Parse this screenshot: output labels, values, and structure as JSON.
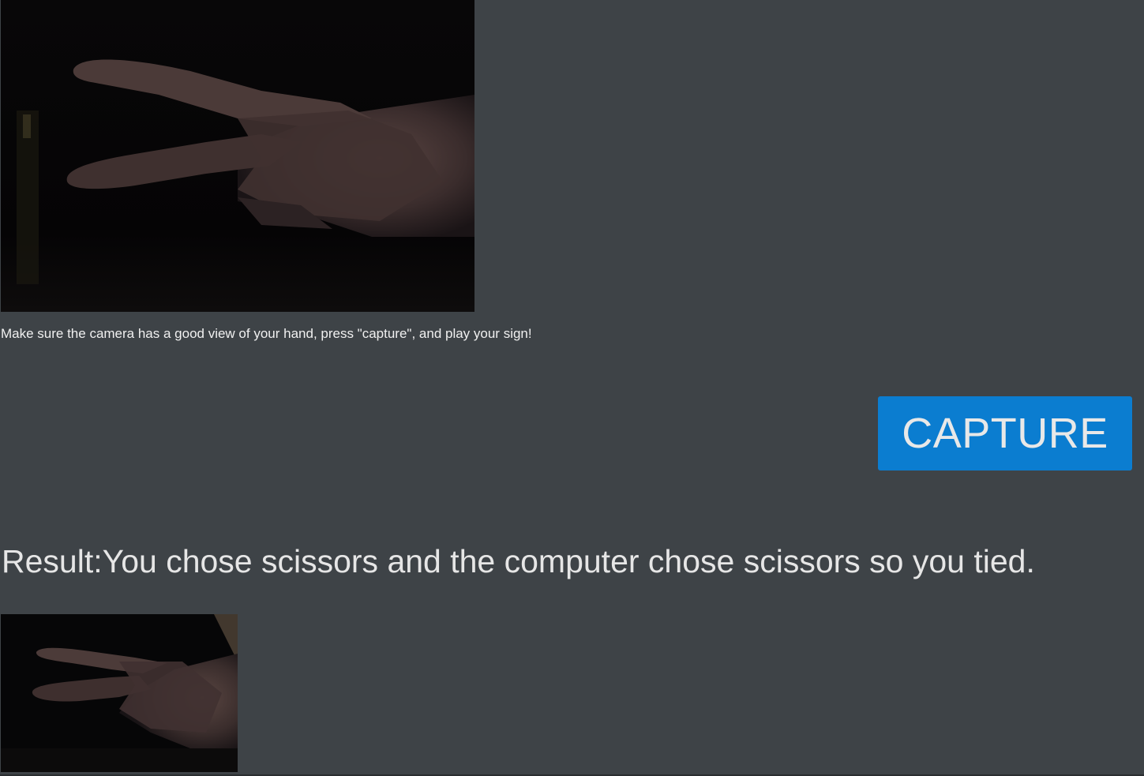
{
  "instructions": "Make sure the camera has a good view of your hand, press \"capture\", and play your sign!",
  "capture_button": {
    "label": "CAPTURE"
  },
  "result": {
    "label": "Result:",
    "text": "You chose scissors and the computer chose scissors so you tied."
  },
  "colors": {
    "background": "#3e4347",
    "button": "#0b7dd0"
  }
}
